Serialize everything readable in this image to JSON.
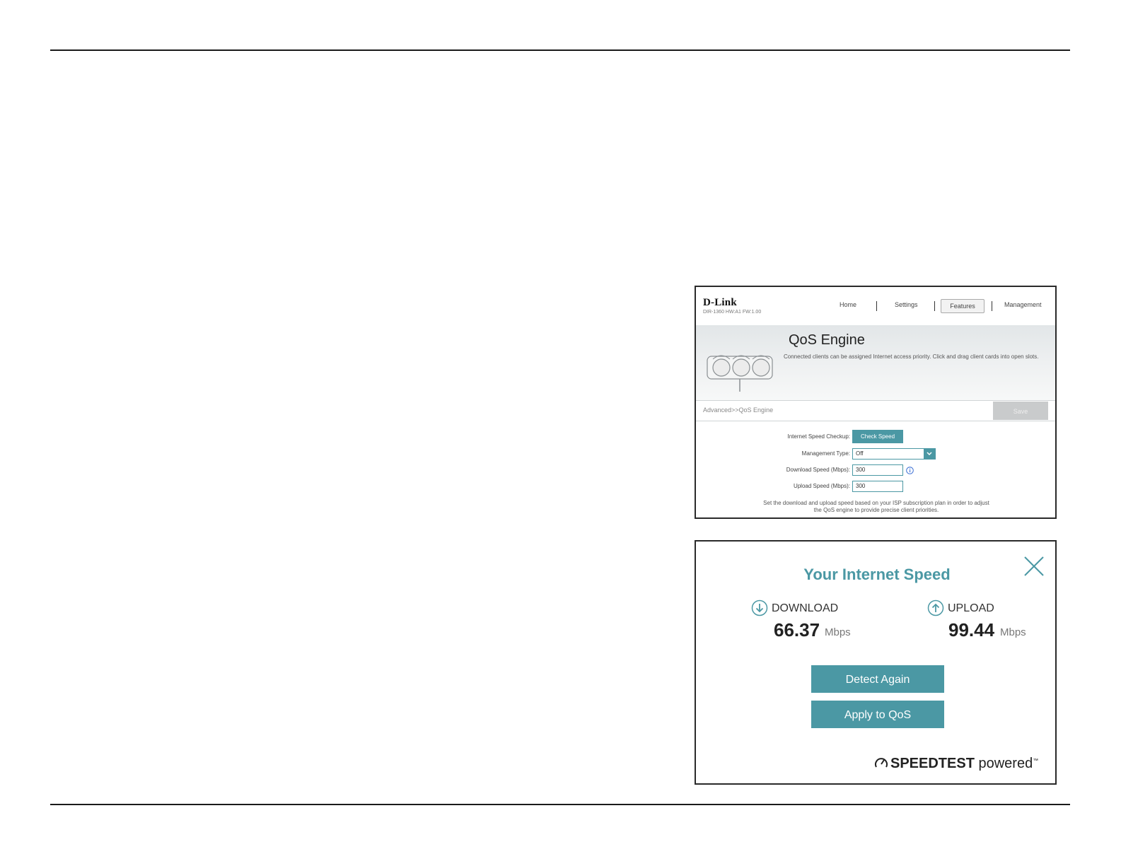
{
  "qos": {
    "logo": "D-Link",
    "model": "DIR-1360 HW:A1 FW:1.00",
    "nav": {
      "home": "Home",
      "settings": "Settings",
      "features": "Features",
      "management": "Management"
    },
    "title": "QoS Engine",
    "description": "Connected clients can be assigned Internet access priority. Click and drag client cards into open slots.",
    "breadcrumb": "Advanced>>QoS Engine",
    "save_label": "Save",
    "speed_checkup_label": "Internet Speed Checkup:",
    "check_speed_label": "Check Speed",
    "management_type_label": "Management Type:",
    "management_type_value": "Off",
    "download_label": "Download Speed (Mbps):",
    "download_value": "300",
    "upload_label": "Upload Speed (Mbps):",
    "upload_value": "300",
    "note_line1": "Set the download and upload speed based on your ISP subscription plan in order to adjust",
    "note_line2": "the QoS engine to provide precise client priorities."
  },
  "speed": {
    "title": "Your Internet Speed",
    "download_label": "DOWNLOAD",
    "download_value": "66.37",
    "upload_label": "UPLOAD",
    "upload_value": "99.44",
    "unit": "Mbps",
    "detect_again_label": "Detect Again",
    "apply_label": "Apply to QoS",
    "powered_brand": "SPEEDTEST",
    "powered_word": "powered",
    "accent_color": "#4b98a4"
  }
}
